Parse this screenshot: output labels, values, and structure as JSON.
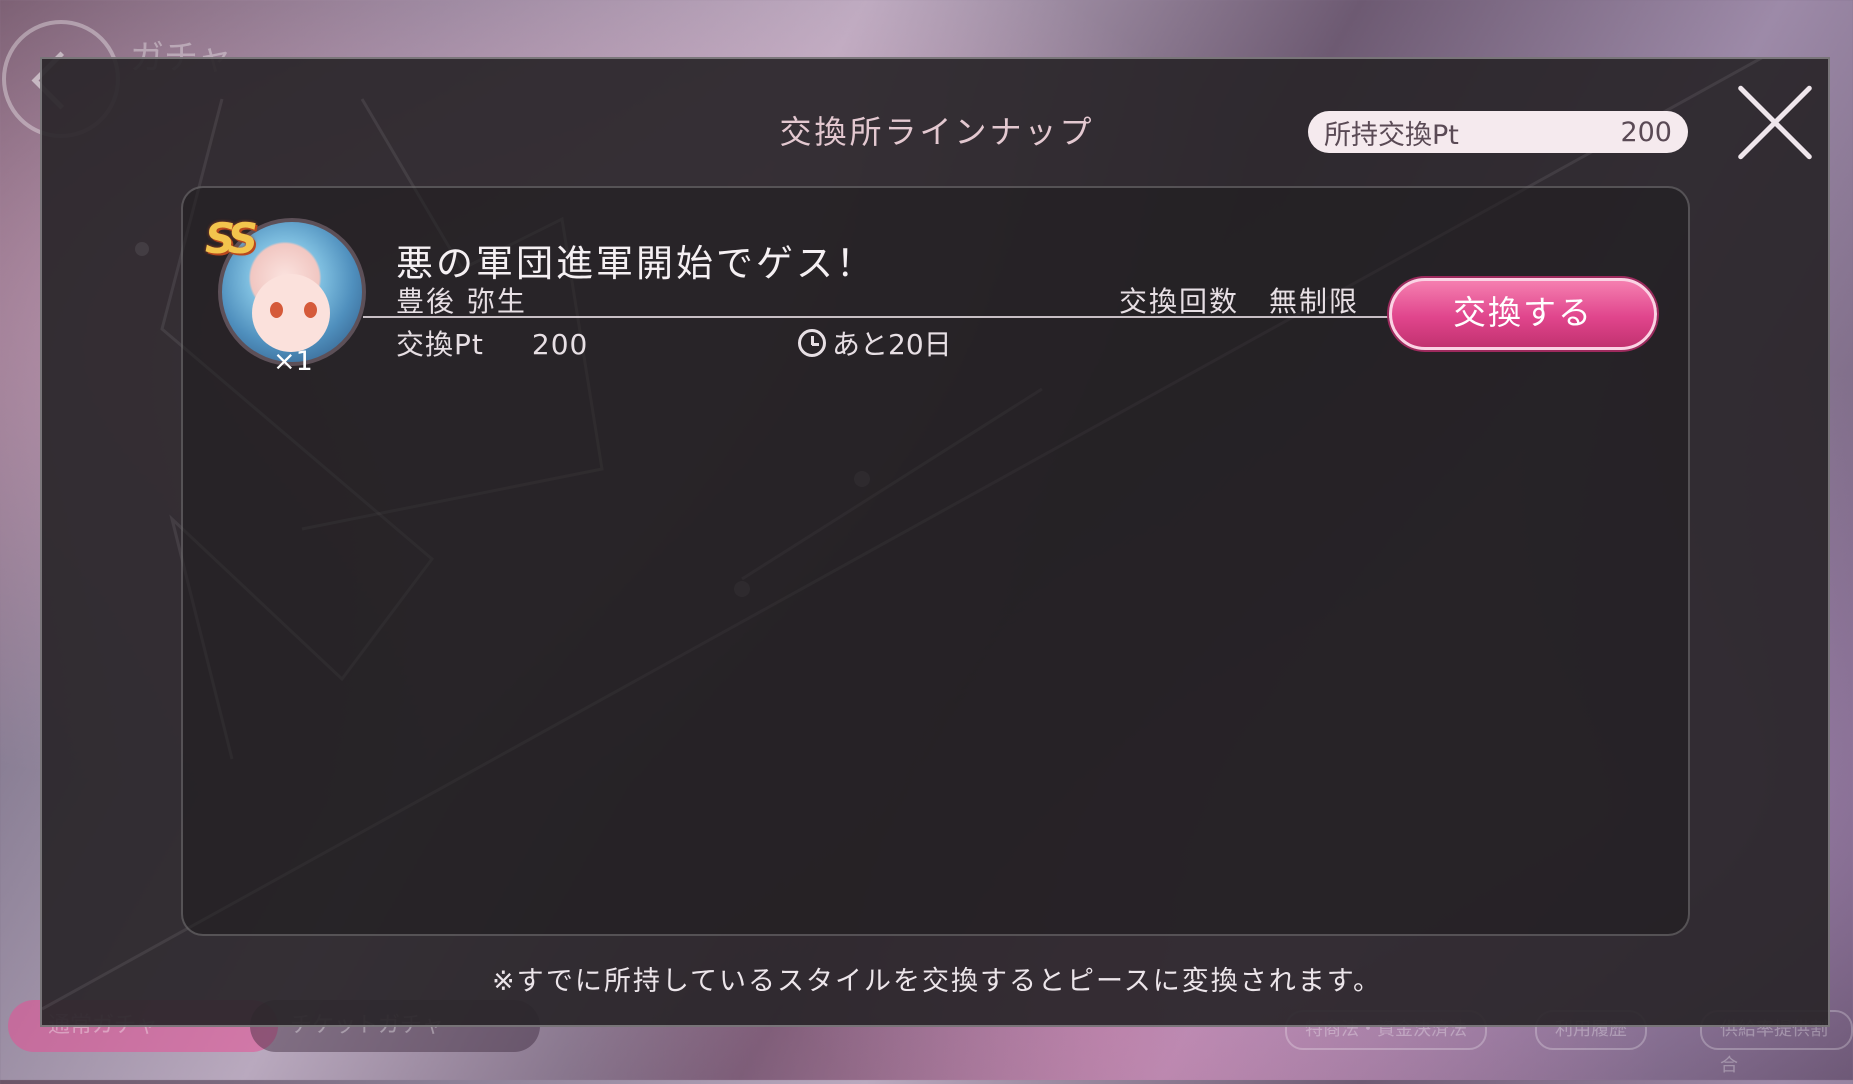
{
  "background": {
    "screen_title": "ガチャ",
    "tabs": [
      "通常ガチャ",
      "チケットガチャ"
    ],
    "links": [
      "特商法・資金決済法",
      "利用履歴",
      "供給率提供割合"
    ]
  },
  "modal": {
    "title": "交換所ラインナップ",
    "points_label": "所持交換Pt",
    "points_value": "200",
    "close_icon": "close-icon"
  },
  "items": [
    {
      "rarity": "SS",
      "count": "×1",
      "name": "悪の軍団進軍開始でゲス！",
      "character": "豊後 弥生",
      "limit_label": "交換回数",
      "limit_value": "無制限",
      "cost_label": "交換Pt",
      "cost_value": "200",
      "remaining": "あと20日",
      "button_label": "交換する"
    }
  ],
  "notice": "※すでに所持しているスタイルを交換するとピースに変換されます。",
  "colors": {
    "accent_pink": "#e0458c",
    "panel_bg": "#2a262a",
    "title_text": "#e3c8d0"
  }
}
